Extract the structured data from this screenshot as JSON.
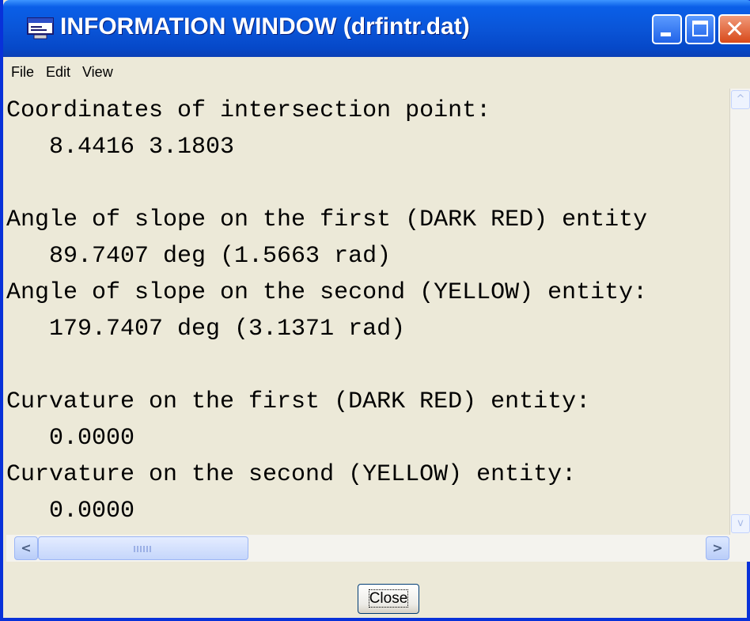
{
  "window": {
    "title": "INFORMATION WINDOW (drfintr.dat)",
    "title_color": "#ffffff",
    "titlebar_color": "#0a55d8",
    "background_color": "#ece9d8"
  },
  "titlebar_buttons": {
    "minimize_icon": "minimize-icon",
    "maximize_icon": "maximize-icon",
    "close_icon": "close-icon",
    "close_glyph": "✕"
  },
  "menu": {
    "items": [
      "File",
      "Edit",
      "View"
    ]
  },
  "content": {
    "lines": [
      "Coordinates of intersection point:",
      "   8.4416 3.1803",
      "",
      "Angle of slope on the first (DARK RED) entity",
      "   89.7407 deg (1.5663 rad)",
      "Angle of slope on the second (YELLOW) entity:",
      "   179.7407 deg (3.1371 rad)",
      "",
      "Curvature on the first (DARK RED) entity:",
      "   0.0000",
      "Curvature on the second (YELLOW) entity:",
      "   0.0000"
    ]
  },
  "scrollbars": {
    "up_glyph": "^",
    "down_glyph": "v",
    "left_glyph": "<",
    "right_glyph": ">"
  },
  "footer": {
    "close_label": "Close"
  }
}
